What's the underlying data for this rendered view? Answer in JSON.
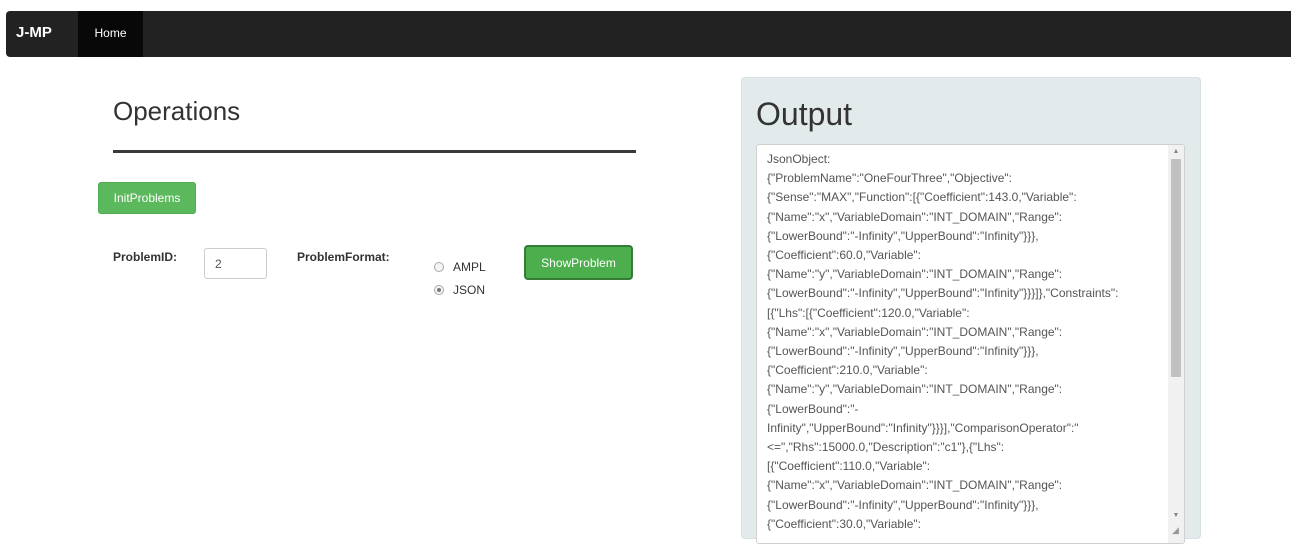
{
  "navbar": {
    "brand": "J-MP",
    "home_label": "Home"
  },
  "operations": {
    "title": "Operations",
    "init_button": "InitProblems",
    "problem_id_label": "ProblemID:",
    "problem_id_value": "2",
    "problem_format_label": "ProblemFormat:",
    "formats": [
      {
        "label": "AMPL",
        "checked": false
      },
      {
        "label": "JSON",
        "checked": true
      }
    ],
    "show_button": "ShowProblem"
  },
  "output": {
    "title": "Output",
    "text": "JsonObject:\n{\"ProblemName\":\"OneFourThree\",\"Objective\":\n{\"Sense\":\"MAX\",\"Function\":[{\"Coefficient\":143.0,\"Variable\":\n{\"Name\":\"x\",\"VariableDomain\":\"INT_DOMAIN\",\"Range\":\n{\"LowerBound\":\"-Infinity\",\"UpperBound\":\"Infinity\"}}},\n{\"Coefficient\":60.0,\"Variable\":\n{\"Name\":\"y\",\"VariableDomain\":\"INT_DOMAIN\",\"Range\":\n{\"LowerBound\":\"-Infinity\",\"UpperBound\":\"Infinity\"}}}]},\"Constraints\":\n[{\"Lhs\":[{\"Coefficient\":120.0,\"Variable\":\n{\"Name\":\"x\",\"VariableDomain\":\"INT_DOMAIN\",\"Range\":\n{\"LowerBound\":\"-Infinity\",\"UpperBound\":\"Infinity\"}}},\n{\"Coefficient\":210.0,\"Variable\":\n{\"Name\":\"y\",\"VariableDomain\":\"INT_DOMAIN\",\"Range\":\n{\"LowerBound\":\"-\nInfinity\",\"UpperBound\":\"Infinity\"}}}],\"ComparisonOperator\":\"\n<=\",\"Rhs\":15000.0,\"Description\":\"c1\"},{\"Lhs\":\n[{\"Coefficient\":110.0,\"Variable\":\n{\"Name\":\"x\",\"VariableDomain\":\"INT_DOMAIN\",\"Range\":\n{\"LowerBound\":\"-Infinity\",\"UpperBound\":\"Infinity\"}}},\n{\"Coefficient\":30.0,\"Variable\":"
  },
  "colors": {
    "navbar_bg": "#222222",
    "success_button": "#5cb85c",
    "output_well_bg": "#e3eaec"
  }
}
